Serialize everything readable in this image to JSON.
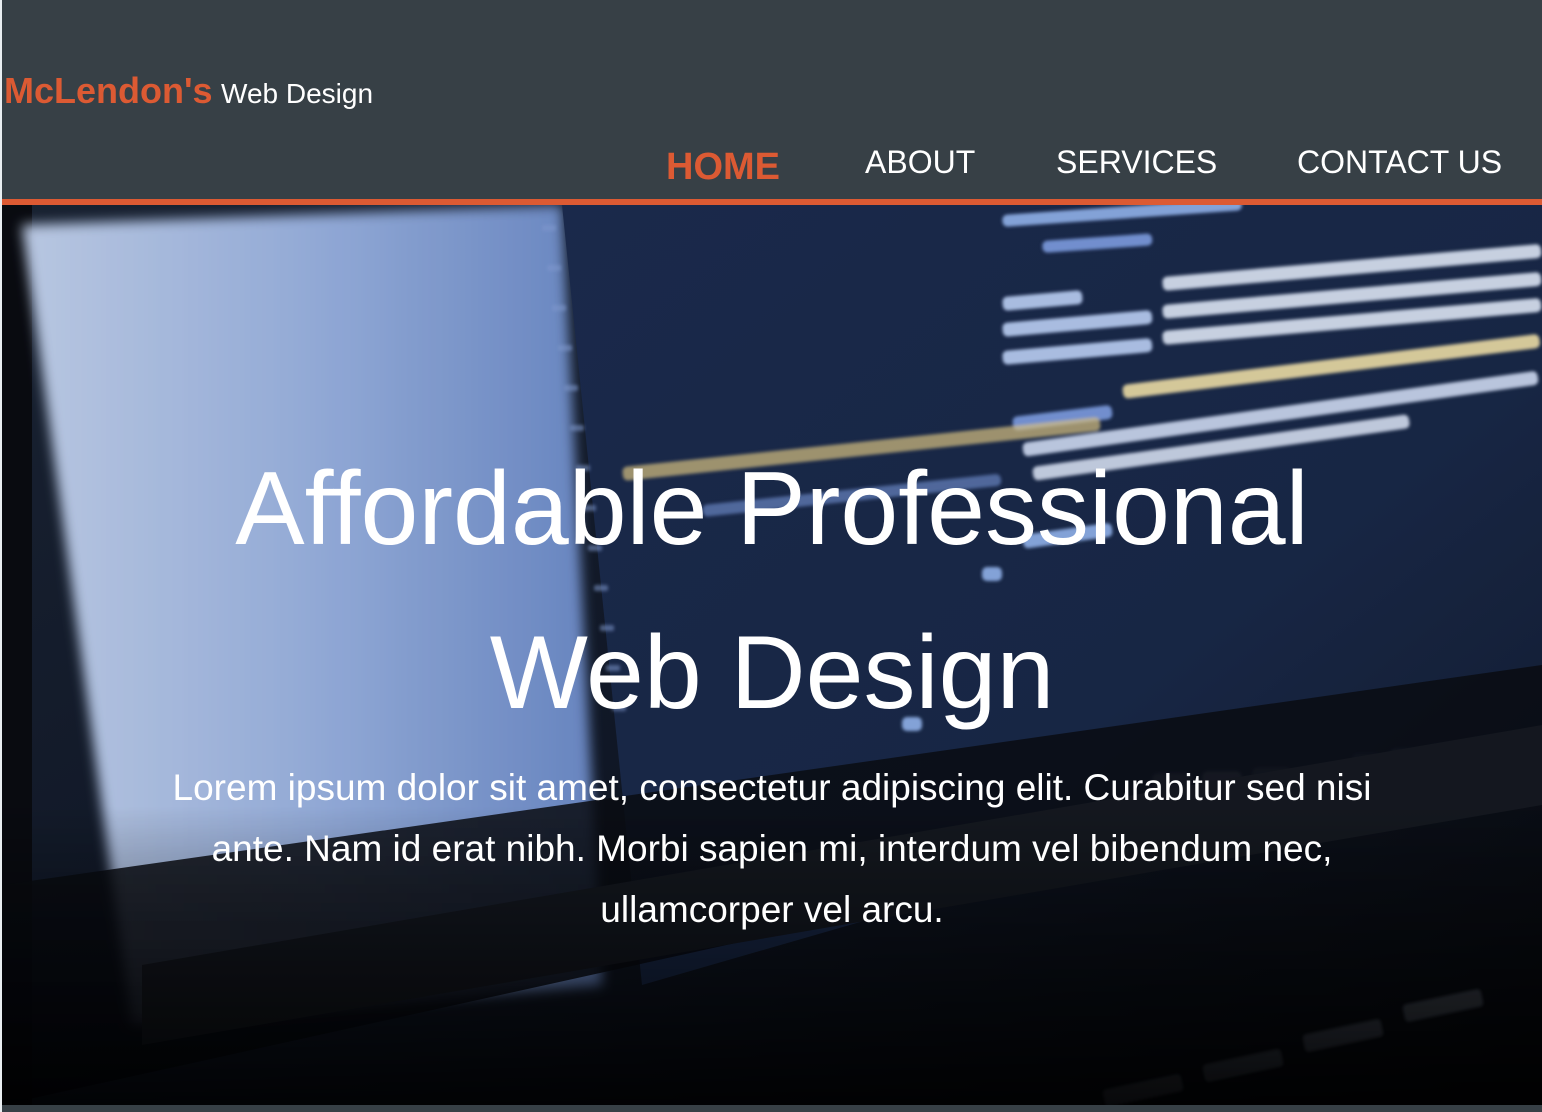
{
  "brand": {
    "name": "McLendon's",
    "tagline": "Web Design"
  },
  "nav": {
    "items": [
      {
        "label": "HOME",
        "active": true
      },
      {
        "label": "ABOUT",
        "active": false
      },
      {
        "label": "SERVICES",
        "active": false
      },
      {
        "label": "CONTACT US",
        "active": false
      }
    ]
  },
  "hero": {
    "title_line1": "Affordable Professional",
    "title_line2": "Web Design",
    "text": "Lorem ipsum dolor sit amet, consectetur adipiscing elit. Curabitur sed nisi ante. Nam id erat nibh. Morbi sapien mi, interdum vel bibendum nec, ullamcorper vel arcu.",
    "background": "laptop-code-photo"
  },
  "colors": {
    "header_bg": "#374046",
    "accent": "#dc5a33",
    "text_light": "#ffffff"
  }
}
